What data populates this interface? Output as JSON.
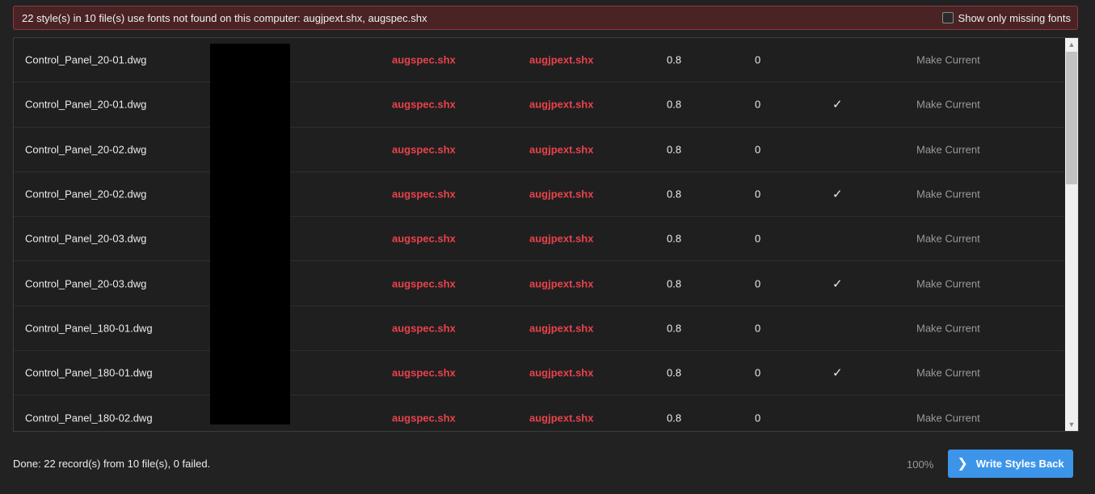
{
  "banner": {
    "message": "22 style(s) in 10 file(s) use fonts not found on this computer: augjpext.shx, augspec.shx",
    "toggle_label": "Show only missing fonts"
  },
  "table": {
    "rows": [
      {
        "file": "Control_Panel_20-01.dwg",
        "font": "augspec.shx",
        "bigfont": "augjpext.shx",
        "width": "0.8",
        "oblique": "0",
        "check": "",
        "action": "Make Current"
      },
      {
        "file": "Control_Panel_20-01.dwg",
        "font": "augspec.shx",
        "bigfont": "augjpext.shx",
        "width": "0.8",
        "oblique": "0",
        "check": "✓",
        "action": "Make Current"
      },
      {
        "file": "Control_Panel_20-02.dwg",
        "font": "augspec.shx",
        "bigfont": "augjpext.shx",
        "width": "0.8",
        "oblique": "0",
        "check": "",
        "action": "Make Current"
      },
      {
        "file": "Control_Panel_20-02.dwg",
        "font": "augspec.shx",
        "bigfont": "augjpext.shx",
        "width": "0.8",
        "oblique": "0",
        "check": "✓",
        "action": "Make Current"
      },
      {
        "file": "Control_Panel_20-03.dwg",
        "font": "augspec.shx",
        "bigfont": "augjpext.shx",
        "width": "0.8",
        "oblique": "0",
        "check": "",
        "action": "Make Current"
      },
      {
        "file": "Control_Panel_20-03.dwg",
        "font": "augspec.shx",
        "bigfont": "augjpext.shx",
        "width": "0.8",
        "oblique": "0",
        "check": "✓",
        "action": "Make Current"
      },
      {
        "file": "Control_Panel_180-01.dwg",
        "font": "augspec.shx",
        "bigfont": "augjpext.shx",
        "width": "0.8",
        "oblique": "0",
        "check": "",
        "action": "Make Current"
      },
      {
        "file": "Control_Panel_180-01.dwg",
        "font": "augspec.shx",
        "bigfont": "augjpext.shx",
        "width": "0.8",
        "oblique": "0",
        "check": "✓",
        "action": "Make Current"
      },
      {
        "file": "Control_Panel_180-02.dwg",
        "font": "augspec.shx",
        "bigfont": "augjpext.shx",
        "width": "0.8",
        "oblique": "0",
        "check": "",
        "action": "Make Current"
      }
    ]
  },
  "footer": {
    "status": "Done: 22 record(s) from 10 file(s), 0 failed.",
    "zoom": "100%",
    "write_button_label": "Write Styles Back"
  },
  "colors": {
    "missing_font": "#e8434b",
    "accent": "#3d95ea",
    "banner_bg": "#4a2325"
  }
}
